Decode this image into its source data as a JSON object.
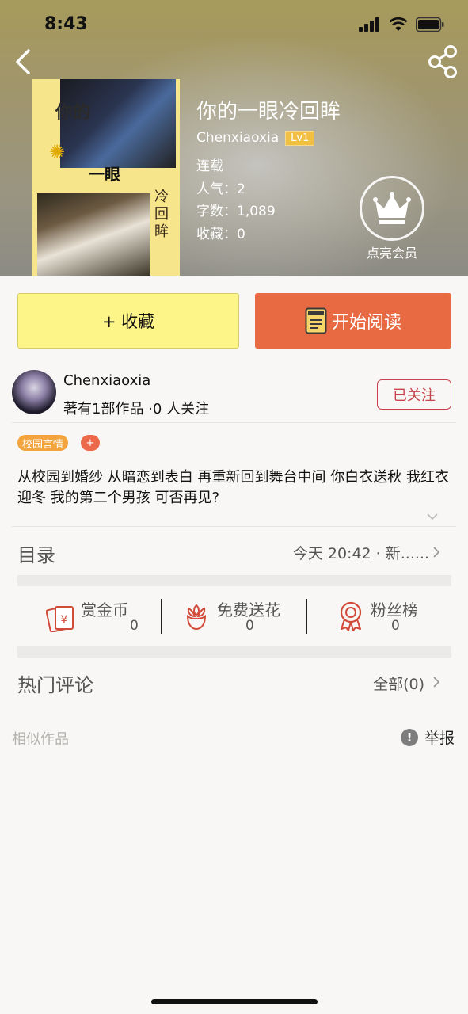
{
  "status_bar": {
    "time": "8:43"
  },
  "header": {
    "cover_text": {
      "line1": "你的",
      "line2": "一眼",
      "line3": "冷回眸"
    },
    "title": "你的一眼冷回眸",
    "author": "Chenxiaoxia",
    "level": "Lv1",
    "status": "连载",
    "popularity_label": "人气：2",
    "word_count_label": "字数：1,089",
    "favorites_label": "收藏：0",
    "vip_label": "点亮会员"
  },
  "actions": {
    "collect_label": "+ 收藏",
    "read_label": "开始阅读"
  },
  "author_row": {
    "name": "Chenxiaoxia",
    "stats": "著有1部作品 ·0 人关注",
    "follow_label": "已关注"
  },
  "tags": [
    {
      "label": "校园言情"
    },
    {
      "label": "+"
    }
  ],
  "description": "从校园到婚纱 从暗恋到表白 再重新回到舞台中间 你白衣送秋 我红衣迎冬 我的第二个男孩 可否再见?",
  "toc": {
    "label": "目录",
    "latest": "今天 20:42 · 新......"
  },
  "stats": [
    {
      "label": "赏金币",
      "value": "0",
      "icon": "reward-coin-icon"
    },
    {
      "label": "免费送花",
      "value": "0",
      "icon": "flower-icon"
    },
    {
      "label": "粉丝榜",
      "value": "0",
      "icon": "medal-icon"
    }
  ],
  "comments": {
    "label": "热门评论",
    "all_label": "全部(0)"
  },
  "footer": {
    "similar_label": "相似作品",
    "report_label": "举报"
  },
  "colors": {
    "accent_orange": "#e86a43",
    "collect_yellow": "#fef589",
    "follow_red": "#c9414a",
    "tag_orange": "#f3a43d"
  }
}
